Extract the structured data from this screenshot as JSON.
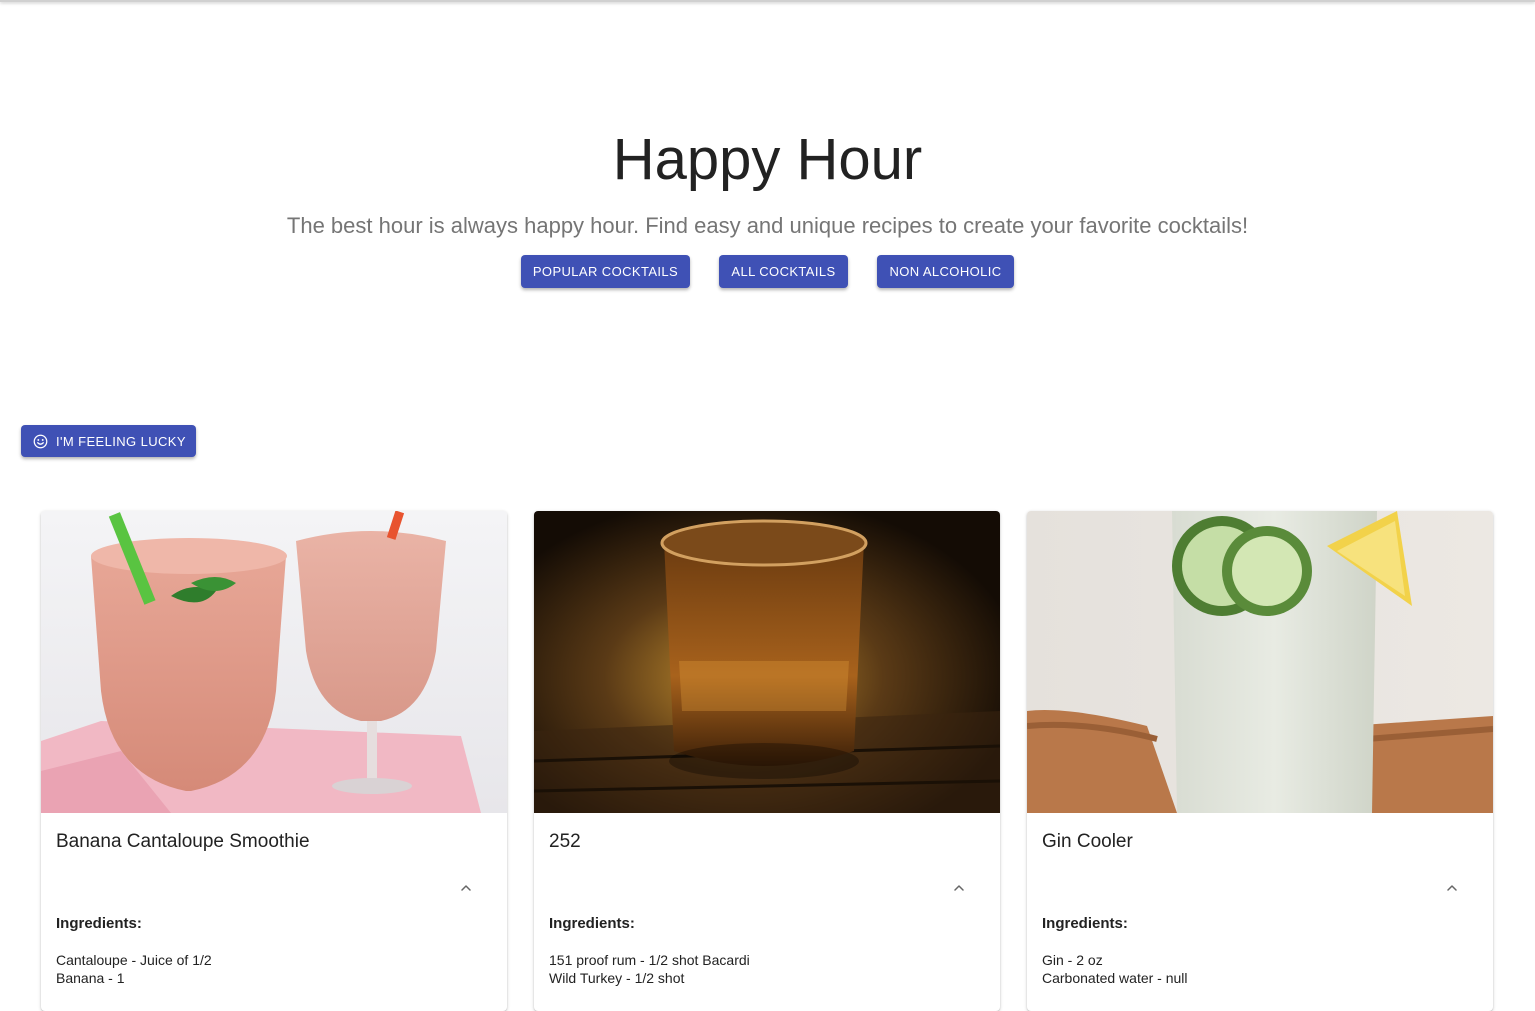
{
  "hero": {
    "title": "Happy Hour",
    "subtitle": "The best hour is always happy hour. Find easy and unique recipes to create your favorite cocktails!"
  },
  "nav": {
    "popular": "POPULAR COCKTAILS",
    "all": "ALL COCKTAILS",
    "non_alcoholic": "NON ALCOHOLIC"
  },
  "lucky": {
    "label": "I'M FEELING LUCKY",
    "icon": "smile-icon"
  },
  "colors": {
    "primary": "#3f51b5"
  },
  "cards": [
    {
      "name": "Banana Cantaloupe Smoothie",
      "ingredients_label": "Ingredients:",
      "ingredients": [
        "Cantaloupe - Juice of 1/2",
        "Banana - 1"
      ]
    },
    {
      "name": "252",
      "ingredients_label": "Ingredients:",
      "ingredients": [
        "151 proof rum - 1/2 shot Bacardi",
        "Wild Turkey - 1/2 shot"
      ]
    },
    {
      "name": "Gin Cooler",
      "ingredients_label": "Ingredients:",
      "ingredients": [
        "Gin - 2 oz",
        "Carbonated water - null"
      ]
    }
  ]
}
